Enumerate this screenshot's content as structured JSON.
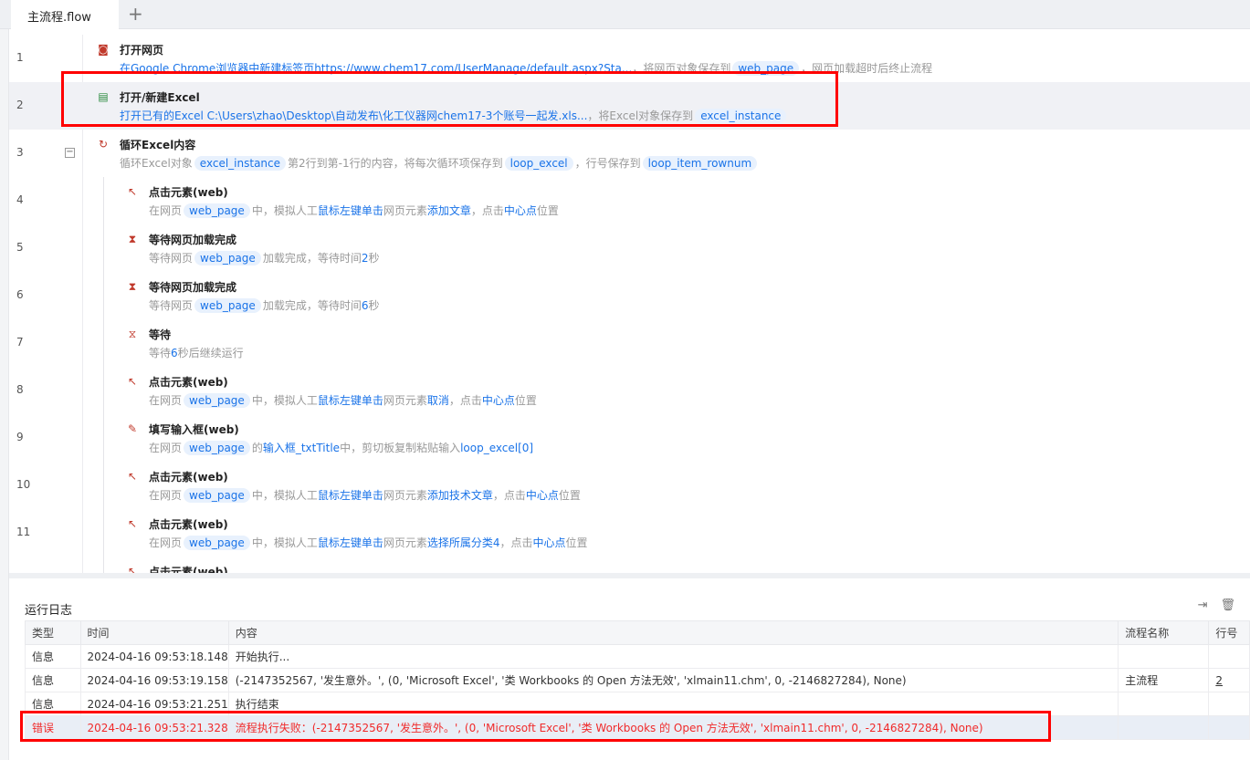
{
  "tabs": {
    "active": "主流程.flow",
    "add": "+"
  },
  "steps": [
    {
      "line": "1",
      "level": 0,
      "icon": "browser-icon",
      "glyph": "◙",
      "title": "打开网页",
      "desc": [
        {
          "t": "在Google Chrome浏览器中新建标签页https://www.chem17.com/UserManage/default.aspx?Sta...",
          "k": "link"
        },
        {
          "t": "，将网页对象保存到",
          "k": "text"
        },
        {
          "t": "web_page",
          "k": "var"
        },
        {
          "t": "，网页加载超时后终止流程",
          "k": "text"
        }
      ]
    },
    {
      "line": "2",
      "level": 0,
      "icon": "excel-file-icon",
      "glyph": "▤",
      "title": "打开/新建Excel",
      "desc": [
        {
          "t": "打开已有的Excel C:\\Users\\zhao\\Desktop\\自动发布\\化工仪器网chem17-3个账号一起发.xls...",
          "k": "link"
        },
        {
          "t": "，将Excel对象保存到",
          "k": "text"
        },
        {
          "t": "excel_instance",
          "k": "var"
        }
      ]
    },
    {
      "line": "3",
      "level": 0,
      "icon": "excel-loop-icon",
      "glyph": "↻",
      "title": "循环Excel内容",
      "desc": [
        {
          "t": "循环Excel对象",
          "k": "text"
        },
        {
          "t": "excel_instance",
          "k": "var"
        },
        {
          "t": "第2行到第-1行的内容，将每次循环项保存到",
          "k": "text"
        },
        {
          "t": "loop_excel",
          "k": "var"
        },
        {
          "t": "，行号保存到",
          "k": "text"
        },
        {
          "t": "loop_item_rownum",
          "k": "var"
        }
      ]
    },
    {
      "line": "4",
      "level": 1,
      "icon": "click-element-icon",
      "glyph": "↖",
      "title": "点击元素(web)",
      "desc": [
        {
          "t": "在网页",
          "k": "text"
        },
        {
          "t": "web_page",
          "k": "var"
        },
        {
          "t": "中，模拟人工",
          "k": "text"
        },
        {
          "t": "鼠标左键单击",
          "k": "link"
        },
        {
          "t": "网页元素",
          "k": "text"
        },
        {
          "t": "添加文章",
          "k": "link"
        },
        {
          "t": "，点击",
          "k": "text"
        },
        {
          "t": "中心点",
          "k": "link"
        },
        {
          "t": "位置",
          "k": "text"
        }
      ]
    },
    {
      "line": "5",
      "level": 1,
      "icon": "wait-page-icon",
      "glyph": "⧗",
      "title": "等待网页加载完成",
      "desc": [
        {
          "t": "等待网页",
          "k": "text"
        },
        {
          "t": "web_page",
          "k": "var"
        },
        {
          "t": "加载完成，等待时间",
          "k": "text"
        },
        {
          "t": "2",
          "k": "link"
        },
        {
          "t": "秒",
          "k": "text"
        }
      ]
    },
    {
      "line": "6",
      "level": 1,
      "icon": "wait-page-icon",
      "glyph": "⧗",
      "title": "等待网页加载完成",
      "desc": [
        {
          "t": "等待网页",
          "k": "text"
        },
        {
          "t": "web_page",
          "k": "var"
        },
        {
          "t": "加载完成，等待时间",
          "k": "text"
        },
        {
          "t": "6",
          "k": "link"
        },
        {
          "t": "秒",
          "k": "text"
        }
      ]
    },
    {
      "line": "7",
      "level": 1,
      "icon": "hourglass-icon",
      "glyph": "⧖",
      "title": "等待",
      "desc": [
        {
          "t": "等待",
          "k": "text"
        },
        {
          "t": "6",
          "k": "link"
        },
        {
          "t": "秒后继续运行",
          "k": "text"
        }
      ]
    },
    {
      "line": "8",
      "level": 1,
      "icon": "click-element-icon",
      "glyph": "↖",
      "title": "点击元素(web)",
      "desc": [
        {
          "t": "在网页",
          "k": "text"
        },
        {
          "t": "web_page",
          "k": "var"
        },
        {
          "t": "中，模拟人工",
          "k": "text"
        },
        {
          "t": "鼠标左键单击",
          "k": "link"
        },
        {
          "t": "网页元素",
          "k": "text"
        },
        {
          "t": "取消",
          "k": "link"
        },
        {
          "t": "，点击",
          "k": "text"
        },
        {
          "t": "中心点",
          "k": "link"
        },
        {
          "t": "位置",
          "k": "text"
        }
      ]
    },
    {
      "line": "9",
      "level": 1,
      "icon": "fill-input-icon",
      "glyph": "✎",
      "title": "填写输入框(web)",
      "desc": [
        {
          "t": "在网页",
          "k": "text"
        },
        {
          "t": "web_page",
          "k": "var"
        },
        {
          "t": "的",
          "k": "text"
        },
        {
          "t": "输入框_txtTitle",
          "k": "link"
        },
        {
          "t": "中，剪切板复制粘贴输入",
          "k": "text"
        },
        {
          "t": "loop_excel[0]",
          "k": "link"
        }
      ]
    },
    {
      "line": "10",
      "level": 1,
      "icon": "click-element-icon",
      "glyph": "↖",
      "title": "点击元素(web)",
      "desc": [
        {
          "t": "在网页",
          "k": "text"
        },
        {
          "t": "web_page",
          "k": "var"
        },
        {
          "t": "中，模拟人工",
          "k": "text"
        },
        {
          "t": "鼠标左键单击",
          "k": "link"
        },
        {
          "t": "网页元素",
          "k": "text"
        },
        {
          "t": "添加技术文章",
          "k": "link"
        },
        {
          "t": "，点击",
          "k": "text"
        },
        {
          "t": "中心点",
          "k": "link"
        },
        {
          "t": "位置",
          "k": "text"
        }
      ]
    },
    {
      "line": "11",
      "level": 1,
      "icon": "click-element-icon",
      "glyph": "↖",
      "title": "点击元素(web)",
      "desc": [
        {
          "t": "在网页",
          "k": "text"
        },
        {
          "t": "web_page",
          "k": "var"
        },
        {
          "t": "中，模拟人工",
          "k": "text"
        },
        {
          "t": "鼠标左键单击",
          "k": "link"
        },
        {
          "t": "网页元素",
          "k": "text"
        },
        {
          "t": "选择所属分类4",
          "k": "link"
        },
        {
          "t": "，点击",
          "k": "text"
        },
        {
          "t": "中心点",
          "k": "link"
        },
        {
          "t": "位置",
          "k": "text"
        }
      ]
    },
    {
      "line": "",
      "level": 1,
      "icon": "click-element-icon",
      "glyph": "↖",
      "title": "点击元素(web)",
      "desc": []
    }
  ],
  "log": {
    "title": "运行日志",
    "columns": [
      "类型",
      "时间",
      "内容",
      "流程名称",
      "行号"
    ],
    "rows": [
      {
        "type": "信息",
        "time": "2024-04-16 09:53:18.148",
        "content": "开始执行...",
        "flow": "",
        "line": ""
      },
      {
        "type": "信息",
        "time": "2024-04-16 09:53:19.158",
        "content": "(-2147352567, '发生意外。', (0, 'Microsoft Excel', '类 Workbooks 的 Open 方法无效', 'xlmain11.chm', 0, -2146827284), None)",
        "flow": "主流程",
        "line": "2"
      },
      {
        "type": "信息",
        "time": "2024-04-16 09:53:21.251",
        "content": "执行结束",
        "flow": "",
        "line": ""
      },
      {
        "type": "错误",
        "time": "2024-04-16 09:53:21.328",
        "content": "流程执行失败：(-2147352567, '发生意外。', (0, 'Microsoft Excel', '类 Workbooks 的 Open 方法无效', 'xlmain11.chm', 0, -2146827284), None)",
        "flow": "",
        "line": "",
        "error": true
      }
    ]
  },
  "colors": {
    "accent": "#1a73e8",
    "error": "#f02b2b",
    "highlight": "#ff0000"
  }
}
